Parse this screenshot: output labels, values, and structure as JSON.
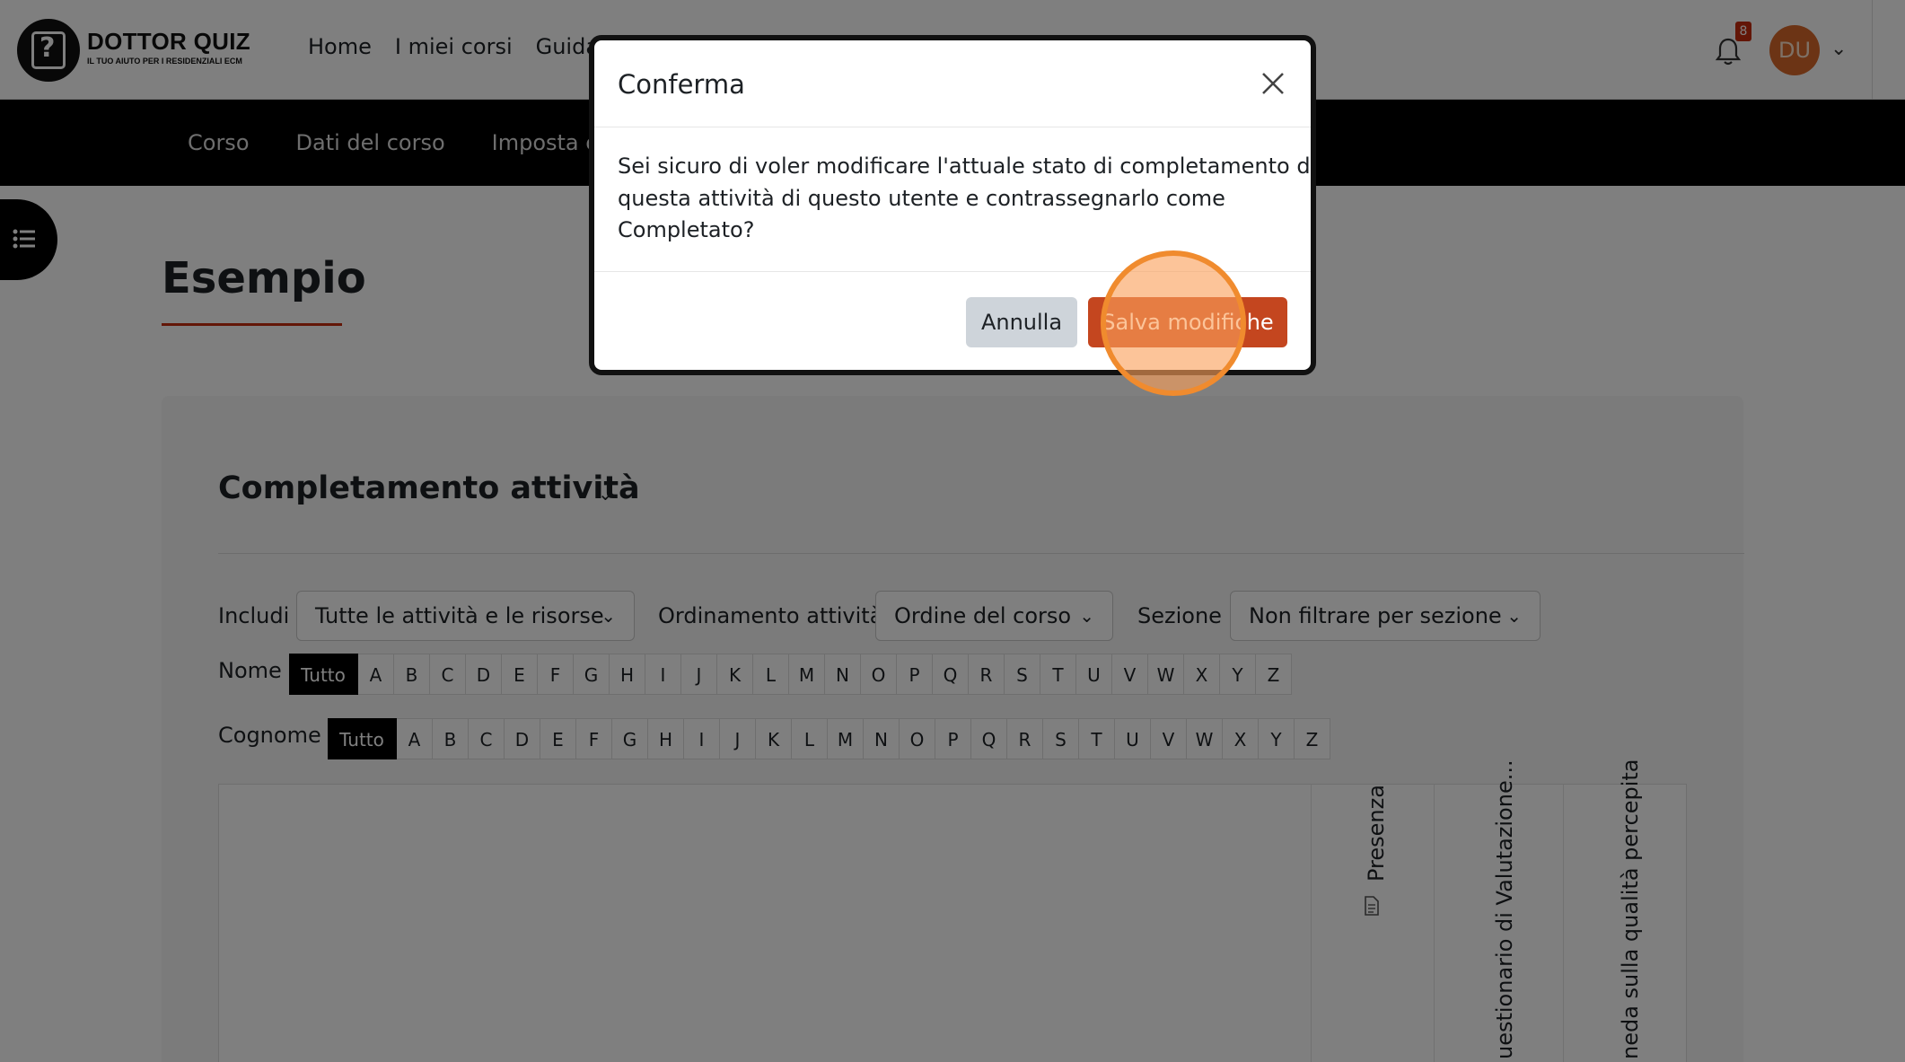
{
  "brand": {
    "title": "DOTTOR QUIZ",
    "tagline": "IL TUO AIUTO PER I RESIDENZIALI ECM"
  },
  "topnav": {
    "items": [
      "Home",
      "I miei corsi",
      "Guida"
    ]
  },
  "notifications": {
    "count": "8"
  },
  "user": {
    "initials": "DU"
  },
  "secnav": {
    "items": [
      "Corso",
      "Dati del corso",
      "Imposta ch"
    ]
  },
  "page": {
    "title": "Esempio"
  },
  "report": {
    "title": "Completamento attività",
    "filters": {
      "include_label": "Includi",
      "include_value": "Tutte le attività e le risorse",
      "order_label": "Ordinamento attività",
      "order_value": "Ordine del corso",
      "section_label": "Sezione",
      "section_value": "Non filtrare per sezione"
    },
    "name_filter": {
      "label": "Nome",
      "all": "Tutto",
      "letters": [
        "A",
        "B",
        "C",
        "D",
        "E",
        "F",
        "G",
        "H",
        "I",
        "J",
        "K",
        "L",
        "M",
        "N",
        "O",
        "P",
        "Q",
        "R",
        "S",
        "T",
        "U",
        "V",
        "W",
        "X",
        "Y",
        "Z"
      ]
    },
    "surname_filter": {
      "label": "Cognome",
      "all": "Tutto",
      "letters": [
        "A",
        "B",
        "C",
        "D",
        "E",
        "F",
        "G",
        "H",
        "I",
        "J",
        "K",
        "L",
        "M",
        "N",
        "O",
        "P",
        "Q",
        "R",
        "S",
        "T",
        "U",
        "V",
        "W",
        "X",
        "Y",
        "Z"
      ]
    },
    "columns": [
      "Presenza",
      "uestionario di Valutazione...",
      "neda sulla qualità percepita"
    ]
  },
  "modal": {
    "title": "Conferma",
    "body_lines": [
      "Sei sicuro di voler modificare l'attuale stato di completamento di",
      "questa attività di questo utente e contrassegnarlo come",
      "Completato?"
    ],
    "cancel_label": "Annulla",
    "save_label": "Salva modifiche"
  },
  "colors": {
    "accent": "#c72c0f",
    "save_button": "#c4461f",
    "avatar": "#d9682a",
    "click_highlight": "#f08b2e"
  },
  "icons": {
    "close": "close-icon",
    "bell": "bell-icon",
    "drawer": "list-icon",
    "activity": "document-icon"
  }
}
